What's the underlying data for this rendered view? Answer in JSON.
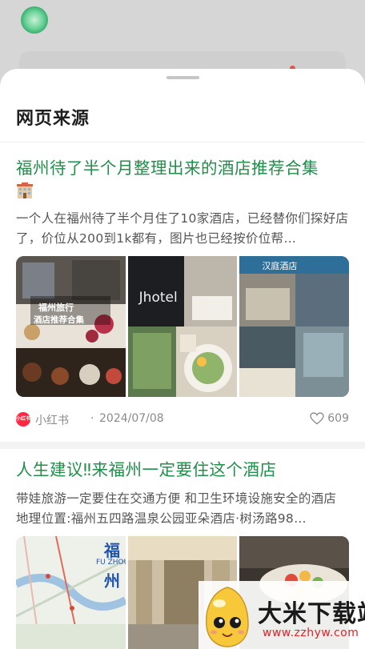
{
  "sheet": {
    "title": "网页来源"
  },
  "results": [
    {
      "title": "福州待了半个月整理出来的酒店推荐合集",
      "title_emoji": "hotel-emoji",
      "description": "一个人在福州待了半个月住了10家酒店，已经替你们探好店了，价位从200到1k都有，图片也已经按价位帮…",
      "image_text_1a": "福州旅行",
      "image_text_1b": "酒店推荐合集",
      "image_text_2": "Jhotel",
      "image_text_3": "汉庭酒店",
      "source": "小红书",
      "source_logo_text": "小红书",
      "separator": "·",
      "date": "2024/07/08",
      "likes": "609"
    },
    {
      "title": "人生建议‼来福州一定要住这个酒店",
      "description": "带娃旅游一定要住在交通方便 和卫生环境设施安全的酒店 地理位置:福州五四路温泉公园亚朵酒店·树汤路98…",
      "image_text_1a": "福",
      "image_text_1b": "州",
      "image_text_1c": "FU ZHOU"
    }
  ],
  "watermark": {
    "title": "大米下载站",
    "url": "www.zzhyw.com"
  },
  "colors": {
    "link_green": "#1f8f4a",
    "source_red": "#ff2741",
    "watermark_red": "#d9252a"
  }
}
